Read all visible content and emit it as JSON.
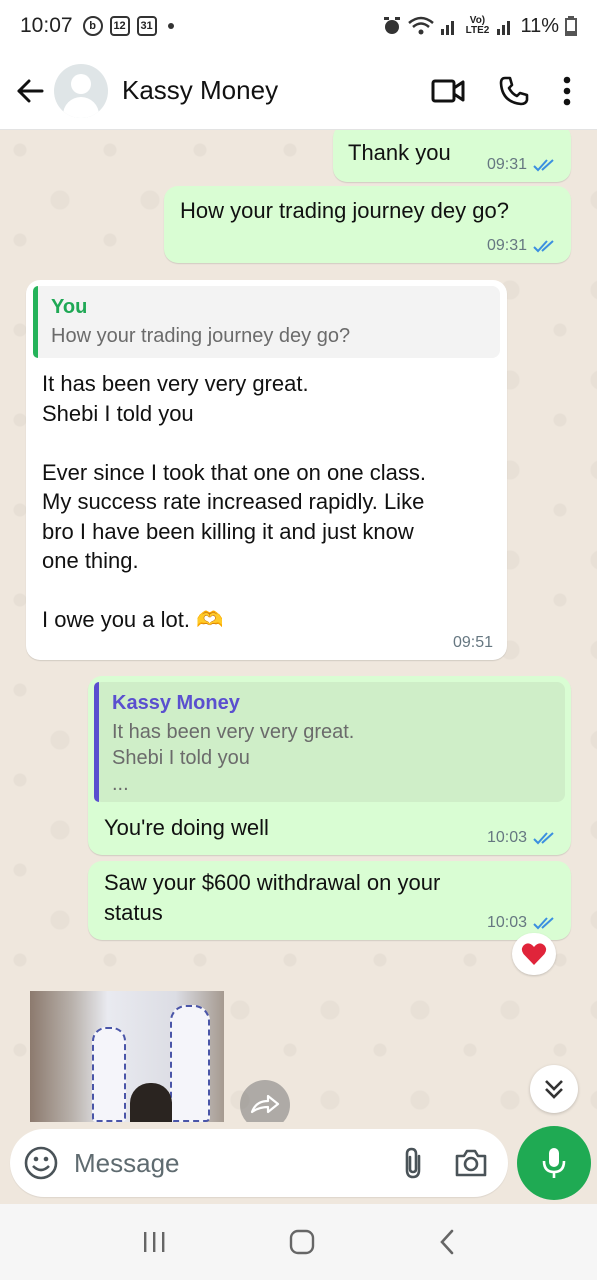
{
  "status_bar": {
    "time": "10:07",
    "icons": [
      "b-icon",
      "calendar-12-icon",
      "calendar-31-icon",
      "dot"
    ],
    "calendar_a": "12",
    "calendar_b": "31",
    "b_letter": "b",
    "network_label": "Vo) LTE2",
    "battery": "11%"
  },
  "header": {
    "contact_name": "Kassy Money"
  },
  "messages": [
    {
      "id": "m1",
      "direction": "out",
      "text": "Thank you",
      "time": "09:31",
      "read": true
    },
    {
      "id": "m2",
      "direction": "out",
      "text": "How your trading  journey dey go?",
      "time": "09:31",
      "read": true
    },
    {
      "id": "m3",
      "direction": "in",
      "reply": {
        "author": "You",
        "text": "How your trading  journey dey go?"
      },
      "text": "It has been very very great.\nShebi I told you\n\nEver since I took that one on one class.\nMy success rate increased rapidly. Like\nbro I have been killing it and just know\none thing.\n\nI owe you a lot. 🫶",
      "time": "09:51"
    },
    {
      "id": "m4",
      "direction": "out",
      "reply": {
        "author": "Kassy Money",
        "text": "It has been very very great.\nShebi I told you\n..."
      },
      "text": "You're doing well",
      "time": "10:03",
      "read": true
    },
    {
      "id": "m5",
      "direction": "out",
      "text": "Saw your $600 withdrawal on your\nstatus",
      "time": "10:03",
      "read": true,
      "reaction": "❤️"
    }
  ],
  "composer": {
    "placeholder": "Message"
  },
  "colors": {
    "outgoing_bubble": "#d9fdd3",
    "incoming_bubble": "#ffffff",
    "accent_green": "#1faa53",
    "read_ticks": "#3b8fe0",
    "reply_author_green": "#1fa855",
    "reply_author_purple": "#5a4fcf"
  }
}
